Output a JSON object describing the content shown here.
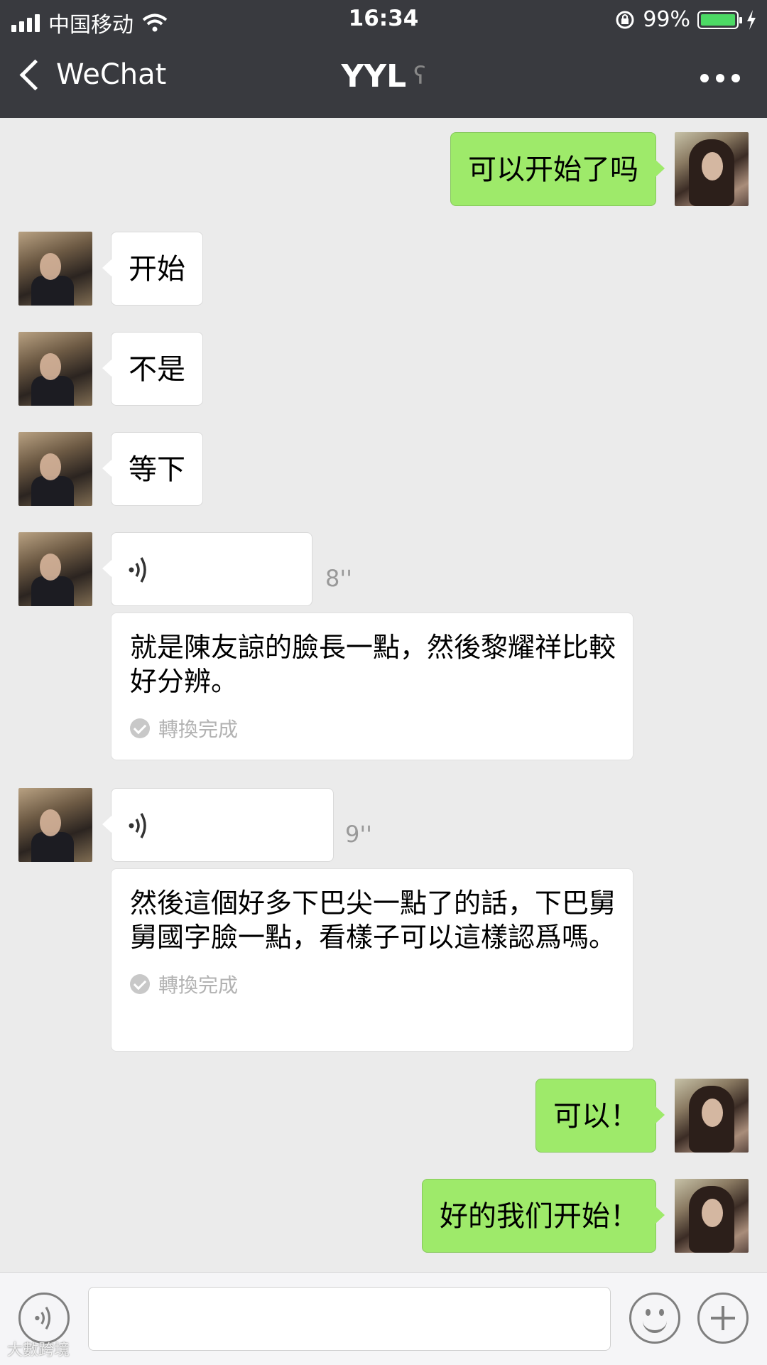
{
  "status_bar": {
    "carrier": "中国移动",
    "time": "16:34",
    "battery": "99%",
    "battery_level": 0.99
  },
  "nav": {
    "back_label": "WeChat",
    "title": "YYL",
    "ear_icon": "earpiece-mode-icon",
    "more_icon": "more-icon"
  },
  "messages": [
    {
      "side": "right",
      "type": "text",
      "text": "可以开始了吗"
    },
    {
      "side": "left",
      "type": "text",
      "text": "开始"
    },
    {
      "side": "left",
      "type": "text",
      "text": "不是"
    },
    {
      "side": "left",
      "type": "text",
      "text": "等下"
    },
    {
      "side": "left",
      "type": "voice",
      "duration": "8''",
      "transcript": "就是陳友諒的臉長一點，然後黎耀祥比較好分辨。",
      "transcript_status": "轉換完成"
    },
    {
      "side": "left",
      "type": "voice",
      "duration": "9''",
      "transcript": "然後這個好多下巴尖一點了的話，下巴舅舅國字臉一點，看樣子可以這樣認爲嗎。",
      "transcript_status": "轉換完成"
    },
    {
      "side": "right",
      "type": "text",
      "text": "可以！"
    },
    {
      "side": "right",
      "type": "text",
      "text": "好的我们开始！"
    }
  ],
  "input_bar": {
    "voice_icon": "voice-input-icon",
    "emoji_icon": "emoji-icon",
    "plus_icon": "plus-icon"
  },
  "watermark": "大數跨境",
  "colors": {
    "header": "#393a3f",
    "chat_bg": "#ebebeb",
    "green_bubble": "#9eea6a",
    "battery_green": "#4cd964"
  }
}
